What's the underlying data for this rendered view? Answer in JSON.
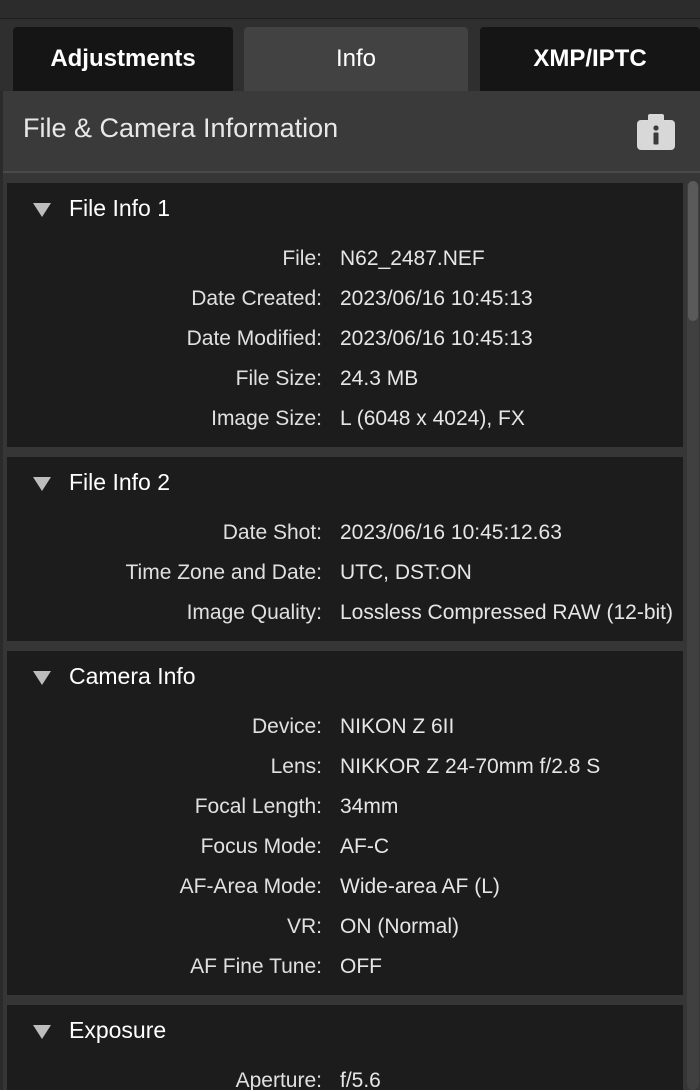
{
  "tabs": [
    {
      "label": "Adjustments"
    },
    {
      "label": "Info"
    },
    {
      "label": "XMP/IPTC"
    }
  ],
  "panel": {
    "title": "File & Camera Information",
    "icon": "info-camera-icon"
  },
  "sections": {
    "file_info_1": {
      "title": "File Info 1",
      "rows": [
        {
          "label": "File:",
          "value": "N62_2487.NEF"
        },
        {
          "label": "Date Created:",
          "value": "2023/06/16 10:45:13"
        },
        {
          "label": "Date Modified:",
          "value": "2023/06/16 10:45:13"
        },
        {
          "label": "File Size:",
          "value": "24.3 MB"
        },
        {
          "label": "Image Size:",
          "value": "L (6048 x 4024), FX"
        }
      ]
    },
    "file_info_2": {
      "title": "File Info 2",
      "rows": [
        {
          "label": "Date Shot:",
          "value": "2023/06/16 10:45:12.63"
        },
        {
          "label": "Time Zone and Date:",
          "value": "UTC, DST:ON"
        },
        {
          "label": "Image Quality:",
          "value": "Lossless Compressed RAW (12-bit)"
        }
      ]
    },
    "camera_info": {
      "title": "Camera Info",
      "rows": [
        {
          "label": "Device:",
          "value": "NIKON Z 6II"
        },
        {
          "label": "Lens:",
          "value": "NIKKOR Z 24-70mm f/2.8 S"
        },
        {
          "label": "Focal Length:",
          "value": "34mm"
        },
        {
          "label": "Focus Mode:",
          "value": "AF-C"
        },
        {
          "label": "AF-Area Mode:",
          "value": "Wide-area AF (L)"
        },
        {
          "label": "VR:",
          "value": "ON (Normal)"
        },
        {
          "label": "AF Fine Tune:",
          "value": "OFF"
        }
      ]
    },
    "exposure": {
      "title": "Exposure",
      "rows": [
        {
          "label": "Aperture:",
          "value": "f/5.6"
        }
      ]
    }
  }
}
